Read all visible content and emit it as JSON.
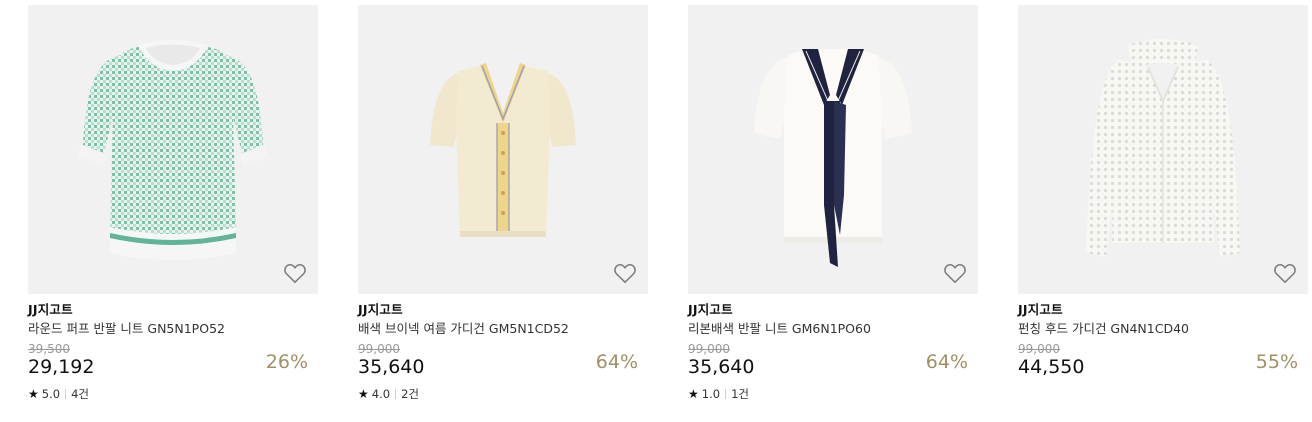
{
  "products": [
    {
      "brand": "JJ지고트",
      "name": "라운드 퍼프 반팔 니트 GN5N1PO52",
      "original_price": "39,500",
      "price": "29,192",
      "discount": "26%",
      "rating": "5.0",
      "reviews": "4건",
      "image_icon": "mint-gingham-puff-sleeve-knit"
    },
    {
      "brand": "JJ지고트",
      "name": "배색 브이넥 여름 가디건 GM5N1CD52",
      "original_price": "99,000",
      "price": "35,640",
      "discount": "64%",
      "rating": "4.0",
      "reviews": "2건",
      "image_icon": "cream-vneck-cardigan"
    },
    {
      "brand": "JJ지고트",
      "name": "리본배색 반팔 니트 GM6N1PO60",
      "original_price": "99,000",
      "price": "35,640",
      "discount": "64%",
      "rating": "1.0",
      "reviews": "1건",
      "image_icon": "white-knit-navy-ribbon"
    },
    {
      "brand": "JJ지고트",
      "name": "펀칭 후드 가디건 GN4N1CD40",
      "original_price": "99,000",
      "price": "44,550",
      "discount": "55%",
      "rating": "",
      "reviews": "",
      "image_icon": "white-crochet-hood-cardigan"
    }
  ],
  "colors": {
    "discount": "#a18f66",
    "image_bg": "#f1f1f1",
    "strike": "#9a9a9a"
  },
  "icons": {
    "wishlist": "heart-outline-icon",
    "rating": "star-icon"
  }
}
